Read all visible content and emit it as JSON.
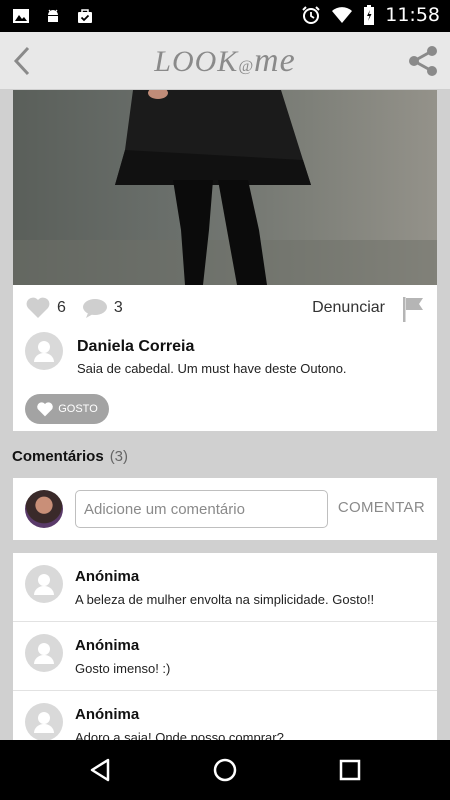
{
  "status_bar": {
    "time": "11:58",
    "left_icons": [
      "image-icon",
      "android-icon",
      "bag-check-icon"
    ],
    "right_icons": [
      "alarm-icon",
      "wifi-icon",
      "battery-icon"
    ]
  },
  "header": {
    "logo_text": "LOOK",
    "logo_at": "@",
    "logo_me": "me",
    "back_icon": "chevron-left-icon",
    "share_icon": "share-icon"
  },
  "post": {
    "likes": "6",
    "comments_count": "3",
    "report_label": "Denunciar",
    "author_name": "Daniela Correia",
    "description": "Saia de cabedal. Um must have deste Outono.",
    "like_button_label": "GOSTO"
  },
  "comments_section": {
    "title": "Comentários",
    "count": "(3)",
    "input_placeholder": "Adicione um comentário",
    "submit_label": "COMENTAR",
    "items": [
      {
        "author": "Anónima",
        "text": "A beleza de mulher envolta na simplicidade. Gosto!!"
      },
      {
        "author": "Anónima",
        "text": "Gosto imenso! :)"
      },
      {
        "author": "Anónima",
        "text": "Adoro a saia! Onde posso comprar?"
      }
    ]
  },
  "colors": {
    "header_bg": "#e8e8e8",
    "page_bg": "#d0d0d0",
    "accent_gray": "#a3a3a3"
  }
}
